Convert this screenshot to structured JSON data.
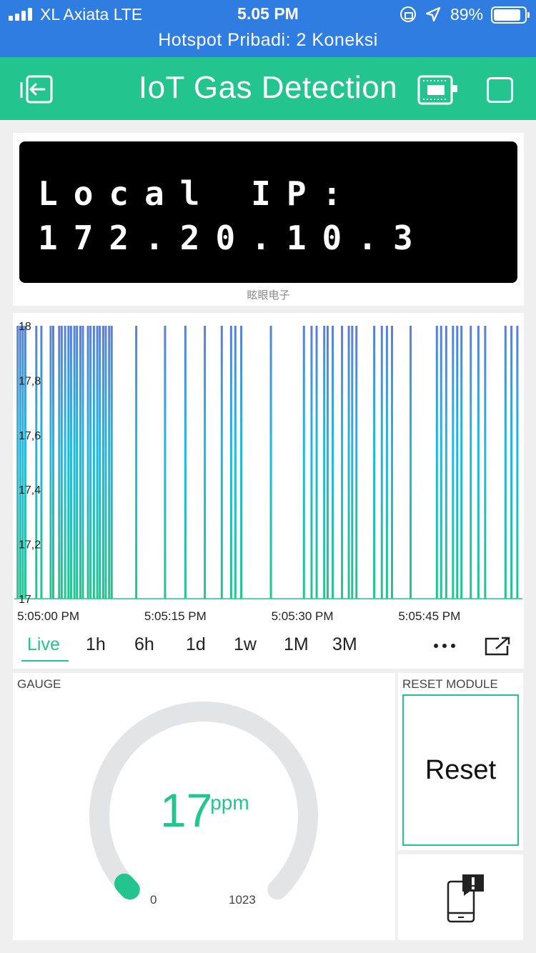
{
  "status_bar": {
    "carrier": "XL Axiata  LTE",
    "time": "5.05 PM",
    "battery_percent": "89%",
    "battery_level": 0.89,
    "hotspot": "Hotspot Pribadi: 2 Koneksi"
  },
  "header": {
    "title": "IoT Gas Detection",
    "accent_color": "#23c48e"
  },
  "lcd": {
    "line1": "Local IP:",
    "line2": "172.20.10.3",
    "caption": "眩眼电子"
  },
  "chart_data": {
    "type": "bar",
    "y_ticks": [
      "18",
      "17,8",
      "17,6",
      "17,4",
      "17,2",
      "17"
    ],
    "ylim": [
      17,
      18
    ],
    "x_ticks": [
      "5:05:00 PM",
      "5:05:15 PM",
      "5:05:30 PM",
      "5:05:45 PM"
    ],
    "x_range_seconds": [
      -3,
      57
    ],
    "colors": {
      "top": "#5a7fd6",
      "mid": "#1fb8e0",
      "bottom": "#23c48e"
    },
    "samples_at_18_seconds": [
      -2.6,
      -2.3,
      -2.0,
      -1.7,
      -0.4,
      0.2,
      1.3,
      1.6,
      2.3,
      2.6,
      3.0,
      3.4,
      3.7,
      4.1,
      4.4,
      4.8,
      5.1,
      5.7,
      6.0,
      6.4,
      6.8,
      7.1,
      7.5,
      7.8,
      8.2,
      8.5,
      11.4,
      14.8,
      17.2,
      19.5,
      21.5,
      22.6,
      23.1,
      23.8,
      27.3,
      31.2,
      32.1,
      32.7,
      33.6,
      34.0,
      34.6,
      35.7,
      36.5,
      36.9,
      37.4,
      39.5,
      40.4,
      41.0,
      41.6,
      43.8,
      46.9,
      47.4,
      48.0,
      48.8,
      49.3,
      49.8,
      50.9,
      51.8,
      52.6,
      55.0,
      55.7,
      56.4
    ]
  },
  "chart_ranges": {
    "items": [
      "Live",
      "1h",
      "6h",
      "1d",
      "1w",
      "1M",
      "3M"
    ],
    "active": "Live"
  },
  "gauge": {
    "label": "GAUGE",
    "value": 17,
    "value_text": "17",
    "unit": "‘ppm",
    "min": "0",
    "max": "1023",
    "min_value": 0,
    "max_value": 1023,
    "track_color": "#e3e4e6",
    "value_color": "#23c48e"
  },
  "reset": {
    "label": "RESET MODULE",
    "button": "Reset"
  },
  "icons": {
    "back": "exit-icon",
    "device": "device-icon",
    "square": "stop-icon",
    "more": "more-icon",
    "expand": "expand-icon",
    "notify": "phone-notification-icon"
  }
}
